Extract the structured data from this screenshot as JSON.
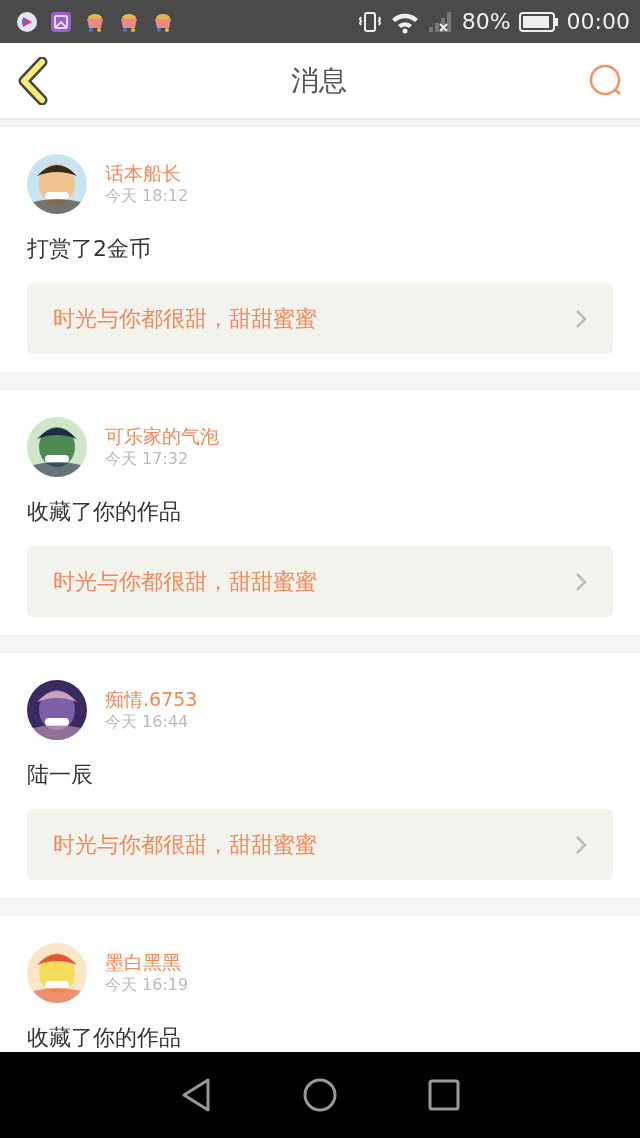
{
  "status_bar": {
    "battery": "80%",
    "time": "00:00"
  },
  "header": {
    "title": "消息"
  },
  "messages": [
    {
      "user": "话本船长",
      "time": "今天 18:12",
      "text": "打赏了2金币",
      "quote": "时光与你都很甜，甜甜蜜蜜"
    },
    {
      "user": "可乐家的气泡",
      "time": "今天 17:32",
      "text": "收藏了你的作品",
      "quote": "时光与你都很甜，甜甜蜜蜜"
    },
    {
      "user": "痴情.6753",
      "time": "今天 16:44",
      "text": "陆一辰",
      "quote": "时光与你都很甜，甜甜蜜蜜"
    },
    {
      "user": "墨白黑黑",
      "time": "今天 16:19",
      "text": "收藏了你的作品"
    }
  ]
}
